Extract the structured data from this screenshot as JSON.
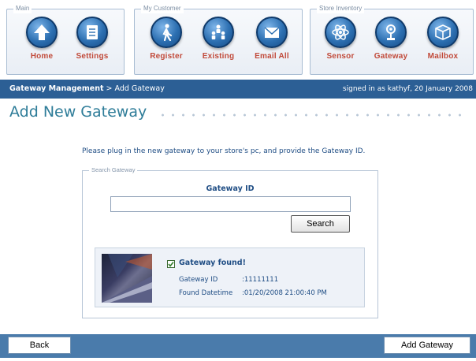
{
  "toolbar": {
    "groups": [
      {
        "title": "Main",
        "buttons": [
          {
            "label": "Home",
            "icon": "up-arrow-icon"
          },
          {
            "label": "Settings",
            "icon": "document-icon"
          }
        ]
      },
      {
        "title": "My Customer",
        "buttons": [
          {
            "label": "Register",
            "icon": "walking-person-icon"
          },
          {
            "label": "Existing",
            "icon": "people-group-icon"
          },
          {
            "label": "Email All",
            "icon": "envelope-icon"
          }
        ]
      },
      {
        "title": "Store Inventory",
        "buttons": [
          {
            "label": "Sensor",
            "icon": "atom-icon"
          },
          {
            "label": "Gateway",
            "icon": "antenna-icon"
          },
          {
            "label": "Mailbox",
            "icon": "box-icon"
          }
        ]
      }
    ],
    "label_color": "#c14a3a",
    "icon_color": "#2c6fb1"
  },
  "nav": {
    "breadcrumb_current": "Gateway Management",
    "breadcrumb_separator": ">",
    "breadcrumb_page": "Add Gateway",
    "signed_in": "signed in as kathyf, 20 January 2008",
    "bar_color": "#2c5f95"
  },
  "page": {
    "title": "Add New Gateway",
    "instruction": "Please plug in the new gateway to your store's pc, and provide the Gateway ID."
  },
  "search": {
    "legend": "Search Gateway",
    "field_label": "Gateway ID",
    "input_value": "",
    "button_label": "Search"
  },
  "result": {
    "found_label": "Gateway found!",
    "checked": true,
    "id_label": "Gateway ID",
    "id_value": ":11111111",
    "datetime_label": "Found Datetime",
    "datetime_value": ":01/20/2008 21:00:40 PM"
  },
  "footer": {
    "back_label": "Back",
    "add_label": "Add Gateway",
    "bar_color": "#4a7bab"
  }
}
